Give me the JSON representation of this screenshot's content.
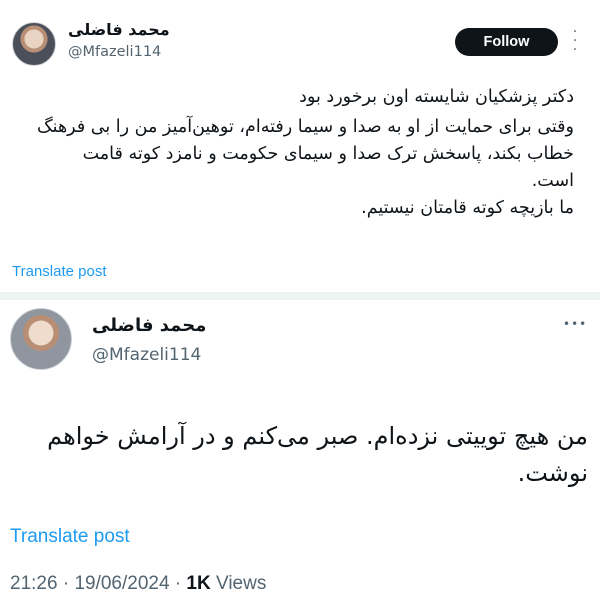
{
  "tweet1": {
    "author_name": "محمد فاضلی",
    "handle": "@Mfazeli114",
    "follow_label": "Follow",
    "lines": [
      "دکتر پزشکیان شایسته اون برخورد بود",
      "وقتی برای حمایت از او به صدا و سیما رفته‌ام، توهین‌آمیز من را بی فرهنگ",
      "خطاب بکند، پاسخش ترک صدا و سیمای حکومت و نامزد کوته قامت",
      "است.",
      "ما بازیچه کوته قامتان نیستیم."
    ],
    "translate_label": "Translate post"
  },
  "tweet2": {
    "author_name": "محمد فاضلی",
    "handle": "@Mfazeli114",
    "lines": [
      "من هیچ توییتی نزده‌ام. صبر می‌کنم و در آرامش خواهم",
      "نوشت."
    ],
    "translate_label": "Translate post",
    "time": "21:26",
    "date": "19/06/2024",
    "views_count": "1K",
    "views_label": "Views"
  },
  "icons": {
    "more": "more-options-icon",
    "avatar": "avatar-photo"
  }
}
